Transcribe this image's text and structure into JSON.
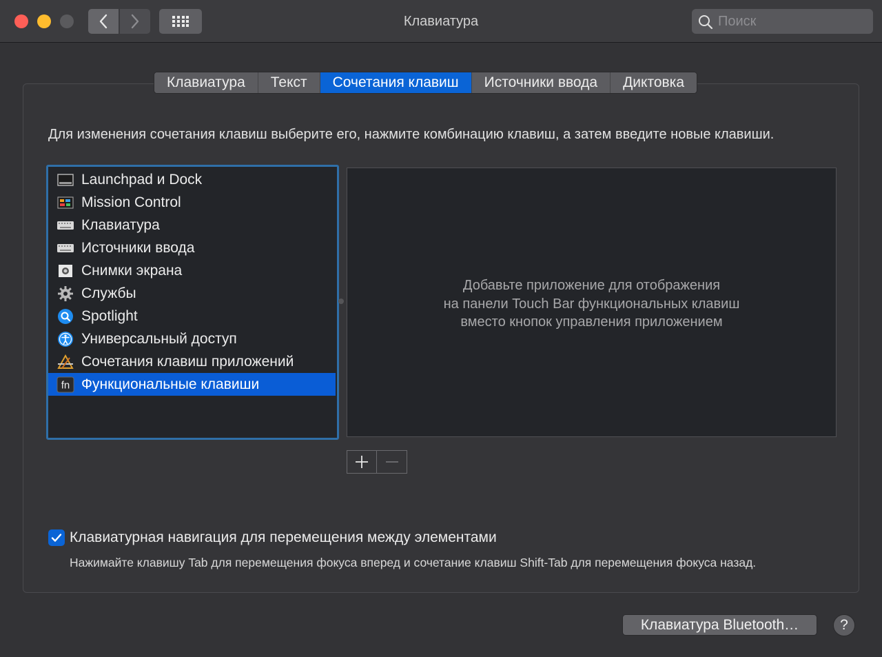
{
  "window": {
    "title": "Клавиатура"
  },
  "search": {
    "placeholder": "Поиск"
  },
  "tabs": [
    {
      "label": "Клавиатура"
    },
    {
      "label": "Текст"
    },
    {
      "label": "Сочетания клавиш",
      "active": true
    },
    {
      "label": "Источники ввода"
    },
    {
      "label": "Диктовка"
    }
  ],
  "instructions": "Для изменения сочетания клавиш выберите его, нажмите комбинацию клавиш, а затем введите новые клавиши.",
  "categories": [
    {
      "label": "Launchpad и Dock",
      "icon": "launchpad-dock-icon"
    },
    {
      "label": "Mission Control",
      "icon": "mission-control-icon"
    },
    {
      "label": "Клавиатура",
      "icon": "keyboard-icon"
    },
    {
      "label": "Источники ввода",
      "icon": "input-sources-icon"
    },
    {
      "label": "Снимки экрана",
      "icon": "screenshot-icon"
    },
    {
      "label": "Службы",
      "icon": "services-gear-icon"
    },
    {
      "label": "Spotlight",
      "icon": "spotlight-icon"
    },
    {
      "label": "Универсальный доступ",
      "icon": "accessibility-icon"
    },
    {
      "label": "Сочетания клавиш приложений",
      "icon": "app-shortcuts-icon"
    },
    {
      "label": "Функциональные клавиши",
      "icon": "fn-icon",
      "selected": true
    }
  ],
  "app_panel": {
    "hint_line1": "Добавьте приложение для отображения",
    "hint_line2": "на панели Touch Bar функциональных клавиш",
    "hint_line3": "вместо кнопок управления приложением"
  },
  "keyboard_nav": {
    "checked": true,
    "label": "Клавиатурная навигация для перемещения между элементами",
    "hint": "Нажимайте клавишу Tab для перемещения фокуса вперед и сочетание клавиш Shift-Tab для перемещения фокуса назад."
  },
  "bottom": {
    "bluetooth_label": "Клавиатура Bluetooth…",
    "help_label": "?"
  },
  "colors": {
    "accent": "#0a64d6",
    "traffic_close": "#fe5f57",
    "traffic_minimize": "#febc2e"
  }
}
